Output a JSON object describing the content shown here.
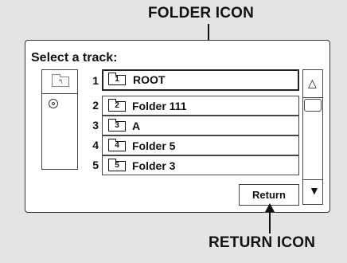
{
  "callouts": {
    "folder_icon": "FOLDER ICON",
    "return_icon": "RETURN ICON"
  },
  "screen": {
    "title": "Select a track:",
    "tracks": [
      {
        "number": "1",
        "icon_number": "1",
        "label": "ROOT"
      },
      {
        "number": "2",
        "icon_number": "2",
        "label": "Folder 111"
      },
      {
        "number": "3",
        "icon_number": "3",
        "label": "A"
      },
      {
        "number": "4",
        "icon_number": "4",
        "label": "Folder 5"
      },
      {
        "number": "5",
        "icon_number": "5",
        "label": "Folder 3"
      }
    ],
    "selected_track": "1",
    "return_label": "Return",
    "scroll_up_glyph": "△",
    "scroll_down_glyph": "▼",
    "left_panel_icons": [
      "folder-icon",
      "disc-icon"
    ]
  }
}
